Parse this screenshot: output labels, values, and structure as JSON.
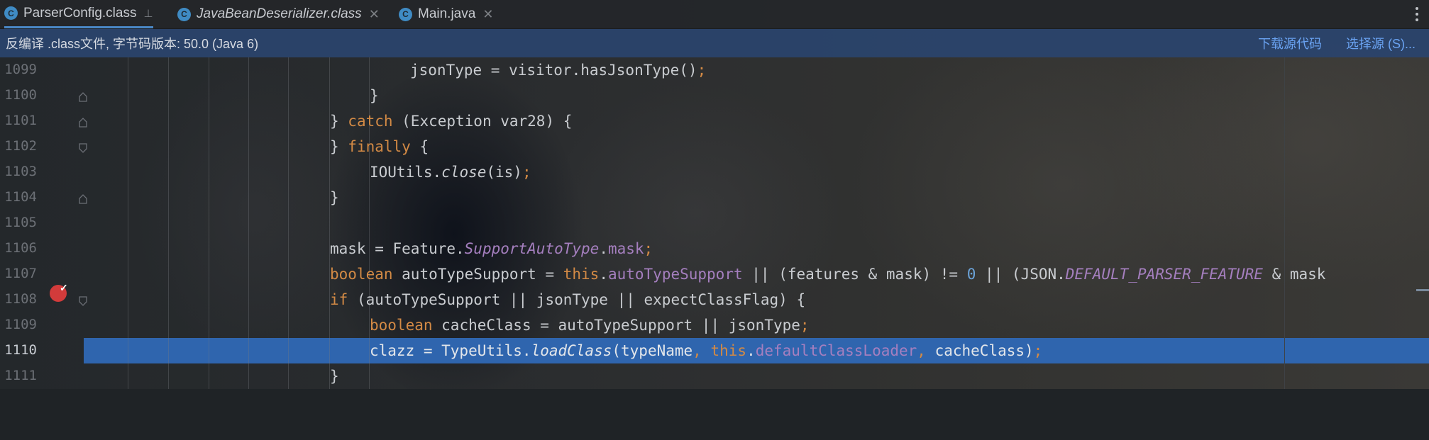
{
  "tabs": [
    {
      "label": "ParserConfig.class",
      "icon": "class-c-icon",
      "active": true
    },
    {
      "label": "JavaBeanDeserializer.class",
      "icon": "class-c-icon",
      "active": false
    },
    {
      "label": "Main.java",
      "icon": "java-file-icon",
      "active": false
    }
  ],
  "banner": {
    "message": "反编译 .class文件, 字节码版本: 50.0 (Java 6)",
    "download_link": "下载源代码",
    "choose_link": "选择源 (S)..."
  },
  "editor": {
    "current_line": "1110",
    "line_numbers": [
      "1099",
      "1100",
      "1101",
      "1102",
      "1103",
      "1104",
      "1105",
      "1106",
      "1107",
      "1108",
      "1109",
      "1110",
      "1111"
    ],
    "colors": {
      "keyword": "#d38a45",
      "field": "#a57fbf",
      "number": "#6ba3d8",
      "highlight": "#2f65ae",
      "banner": "#2a446e"
    }
  }
}
